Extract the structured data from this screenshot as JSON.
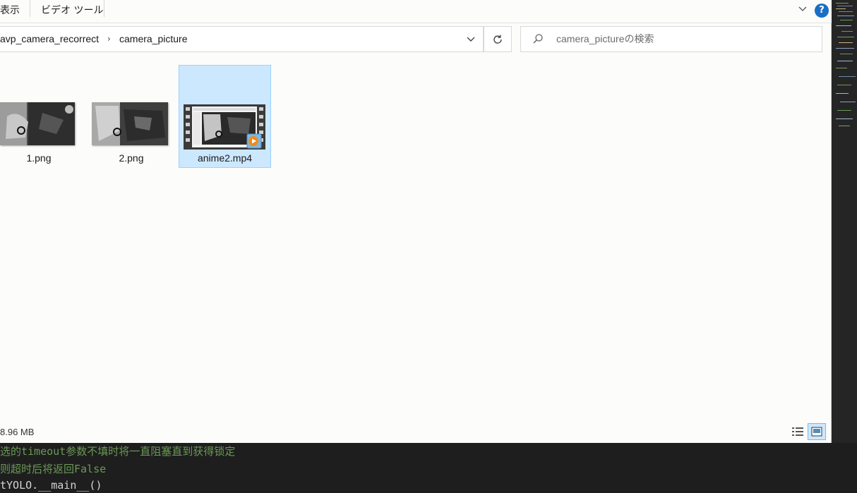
{
  "ribbon": {
    "tab_view": "表示",
    "tab_video_tools": "ビデオ ツール"
  },
  "address": {
    "crumbs": [
      "avp_camera_recorrect",
      "camera_picture"
    ],
    "separator": "›"
  },
  "search": {
    "placeholder": "camera_pictureの検索"
  },
  "files": [
    {
      "name": "1.png",
      "type": "image"
    },
    {
      "name": "2.png",
      "type": "image"
    },
    {
      "name": "anime2.mp4",
      "type": "video",
      "selected": true
    }
  ],
  "status": {
    "text": "8.96 MB"
  },
  "help_label": "?",
  "terminal": {
    "lines": [
      "选的timeout参数不填时将一直阻塞直到获得锁定",
      "则超时后将返回False",
      "tYOLO.__main__()"
    ]
  },
  "colors": {
    "explorer_bg": "#fcfcfa",
    "selection_bg": "#cce8ff",
    "selection_border": "#99d1ff",
    "help_blue": "#1a6fc4",
    "editor_bg": "#1e1e1e",
    "comment_green": "#6a9955"
  }
}
